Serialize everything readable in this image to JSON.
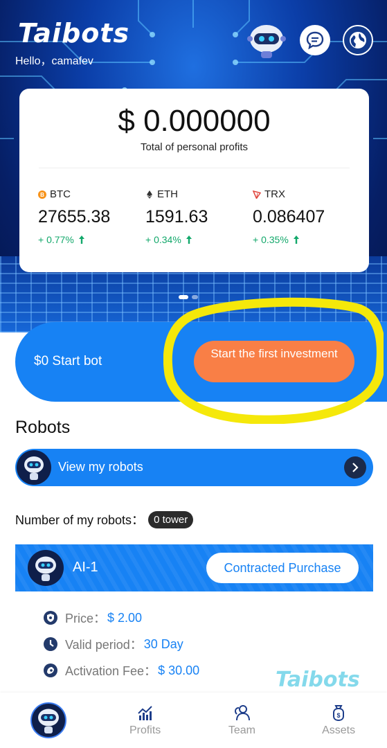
{
  "header": {
    "brand": "Taibots",
    "greeting": "Hello，camafev",
    "icons": [
      "robot-mascot-icon",
      "chat-icon",
      "globe-icon"
    ]
  },
  "profits": {
    "amount": "$ 0.000000",
    "label": "Total of personal profits"
  },
  "coins": [
    {
      "name": "BTC",
      "price": "27655.38",
      "change": "+ 0.77%",
      "icon": "bitcoin-icon",
      "color": "#f7931a"
    },
    {
      "name": "ETH",
      "price": "1591.63",
      "change": "+ 0.34%",
      "icon": "ethereum-icon",
      "color": "#333333"
    },
    {
      "name": "TRX",
      "price": "0.086407",
      "change": "+ 0.35%",
      "icon": "tron-icon",
      "color": "#e0453c"
    }
  ],
  "start_bot": {
    "label": "$0 Start bot",
    "button_label": "Start the first investment"
  },
  "robots": {
    "title": "Robots",
    "view_label": "View my robots",
    "count_label": "Number of my robots：",
    "count_value": "0 tower"
  },
  "robot_card": {
    "name": "AI-1",
    "button_label": "Contracted Purchase",
    "price_label": "Price：",
    "price_value": "$ 2.00",
    "period_label": "Valid period：",
    "period_value": "30 Day",
    "fee_label": "Activation Fee：",
    "fee_value": "$ 30.00"
  },
  "watermark": "Taibots",
  "nav": {
    "profits": "Profits",
    "team": "Team",
    "assets": "Assets"
  },
  "colors": {
    "primary": "#1782f4",
    "accent": "#f97f46",
    "positive": "#13a86b",
    "highlight": "#f5e80a"
  }
}
